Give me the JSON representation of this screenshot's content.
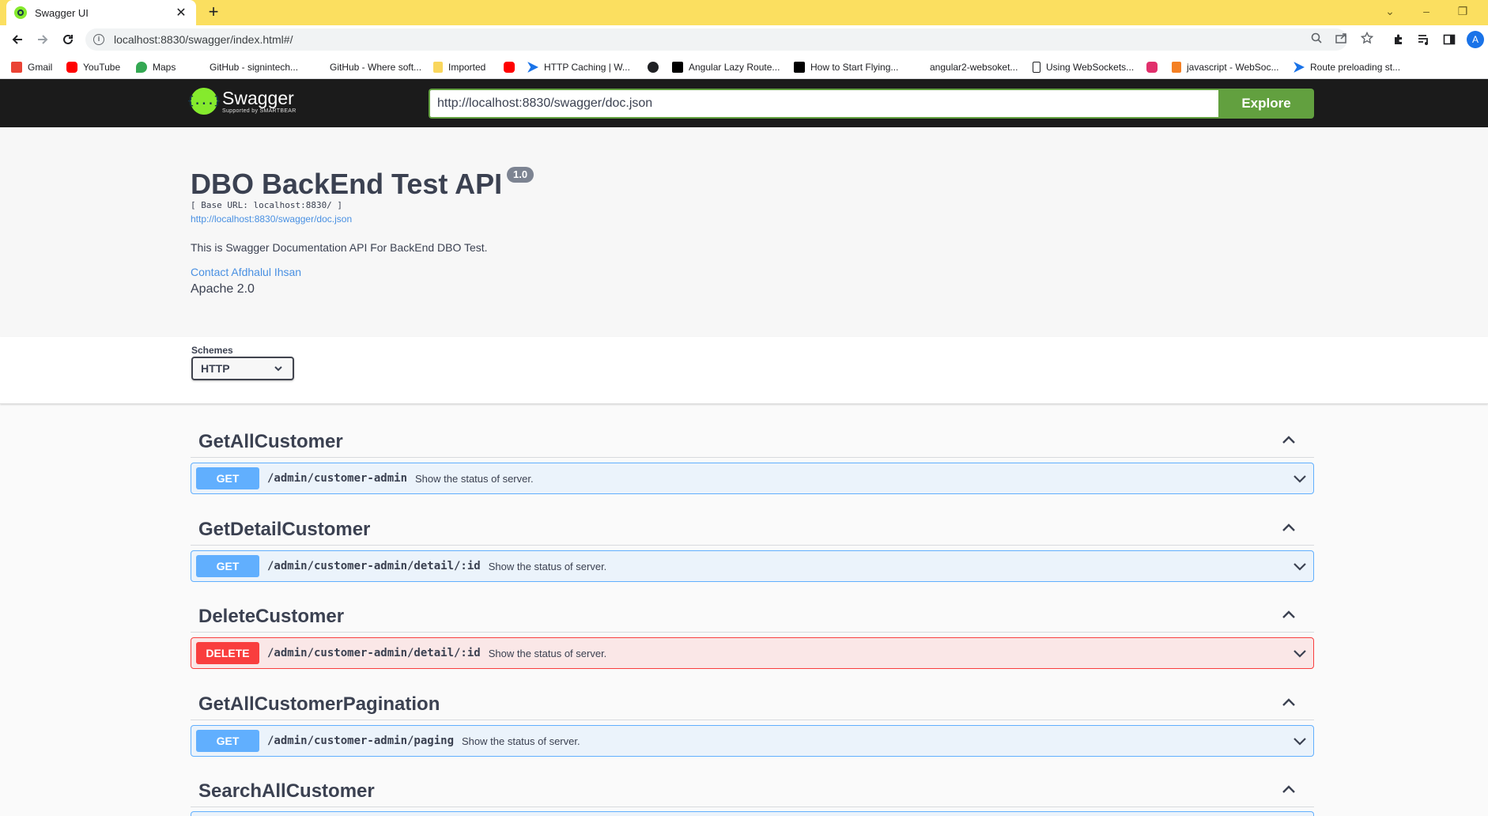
{
  "browser": {
    "tab_title": "Swagger UI",
    "url": "localhost:8830/swagger/index.html#/",
    "avatar_letter": "A",
    "bookmarks": [
      {
        "label": "Gmail",
        "icon": "gmail-icon",
        "color": "#ea4335"
      },
      {
        "label": "YouTube",
        "icon": "youtube-icon",
        "color": "#ff0000"
      },
      {
        "label": "Maps",
        "icon": "maps-icon",
        "color": "#34a853"
      },
      {
        "label": "GitHub - signintech...",
        "icon": "github-icon",
        "color": "#ffffff"
      },
      {
        "label": "GitHub - Where soft...",
        "icon": "github-icon",
        "color": "#ffffff"
      },
      {
        "label": "Imported",
        "icon": "folder-icon",
        "color": "#f9d65c"
      },
      {
        "label": "",
        "icon": "youtube-icon",
        "color": "#ff0000"
      },
      {
        "label": "HTTP Caching | W...",
        "icon": "web-dev-icon",
        "color": "#1a73e8"
      },
      {
        "label": "",
        "icon": "globe-icon",
        "color": "#202124"
      },
      {
        "label": "Angular Lazy Route...",
        "icon": "medium-icon",
        "color": "#000000"
      },
      {
        "label": "How to Start Flying...",
        "icon": "medium-icon",
        "color": "#000000"
      },
      {
        "label": "angular2-websoket...",
        "icon": "github-icon",
        "color": "#ffffff"
      },
      {
        "label": "Using WebSockets...",
        "icon": "dev-icon",
        "color": "#ffffff"
      },
      {
        "label": "",
        "icon": "instagram-icon",
        "color": "#e1306c"
      },
      {
        "label": "javascript - WebSoc...",
        "icon": "stackoverflow-icon",
        "color": "#f48024"
      },
      {
        "label": "Route preloading st...",
        "icon": "web-dev-icon",
        "color": "#1a73e8"
      }
    ]
  },
  "swagger": {
    "logo_name": "Swagger",
    "logo_sub": "Supported by SMARTBEAR",
    "logo_mark": "{...}",
    "spec_url": "http://localhost:8830/swagger/doc.json",
    "explore_label": "Explore"
  },
  "info": {
    "title": "DBO BackEnd Test API",
    "version": "1.0",
    "base_url": "[ Base URL: localhost:8830/ ]",
    "doc_link": "http://localhost:8830/swagger/doc.json",
    "description": "This is Swagger Documentation API For BackEnd DBO Test.",
    "contact": "Contact Afdhalul Ihsan",
    "license": "Apache 2.0"
  },
  "schemes": {
    "label": "Schemes",
    "selected": "HTTP"
  },
  "tags": [
    {
      "name": "GetAllCustomer",
      "op": {
        "method": "GET",
        "path": "/admin/customer-admin",
        "summary": "Show the status of server."
      }
    },
    {
      "name": "GetDetailCustomer",
      "op": {
        "method": "GET",
        "path": "/admin/customer-admin/detail/:id",
        "summary": "Show the status of server."
      }
    },
    {
      "name": "DeleteCustomer",
      "op": {
        "method": "DELETE",
        "path": "/admin/customer-admin/detail/:id",
        "summary": "Show the status of server."
      }
    },
    {
      "name": "GetAllCustomerPagination",
      "op": {
        "method": "GET",
        "path": "/admin/customer-admin/paging",
        "summary": "Show the status of server."
      }
    },
    {
      "name": "SearchAllCustomer"
    }
  ],
  "colors": {
    "get": "#61affe",
    "delete": "#f93e3e",
    "explore": "#62a03f",
    "topbar": "#1b1b1b"
  }
}
